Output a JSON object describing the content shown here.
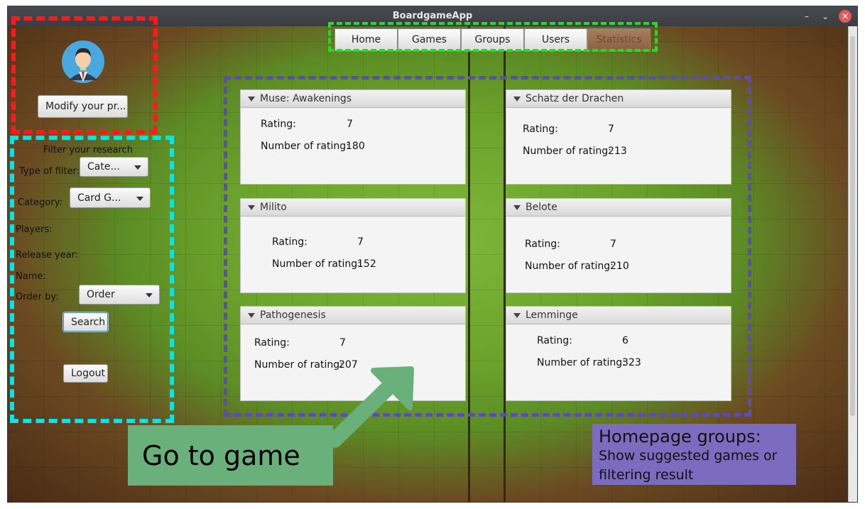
{
  "window": {
    "title": "BoardgameApp",
    "controls": [
      "–",
      "⌄",
      "✕"
    ]
  },
  "nav": {
    "tabs": [
      "Home",
      "Games",
      "Groups",
      "Users",
      "Statistics"
    ]
  },
  "profile": {
    "modify_label": "Modify your pr..."
  },
  "filter": {
    "heading": "Filter your research",
    "type_label": "Type of filter:",
    "type_value": "Cate...",
    "category_label": "Category:",
    "category_value": "Card G...",
    "players_label": "Players:",
    "release_label": "Release year:",
    "name_label": "Name:",
    "order_label": "Order by:",
    "order_value": "Order",
    "search_label": "Search",
    "logout_label": "Logout"
  },
  "games": [
    {
      "name": "Muse: Awakenings",
      "rating_label": "Rating:",
      "rating": "7",
      "count_label": "Number of rating:",
      "count": "180"
    },
    {
      "name": "Schatz der Drachen",
      "rating_label": "Rating:",
      "rating": "7",
      "count_label": "Number of rating:",
      "count": "213"
    },
    {
      "name": "Milito",
      "rating_label": "Rating:",
      "rating": "7",
      "count_label": "Number of rating:",
      "count": "152"
    },
    {
      "name": "Belote",
      "rating_label": "Rating:",
      "rating": "7",
      "count_label": "Number of rating:",
      "count": "210"
    },
    {
      "name": "Pathogenesis",
      "rating_label": "Rating:",
      "rating": "7",
      "count_label": "Number of rating:",
      "count": "207"
    },
    {
      "name": "Lemminge",
      "rating_label": "Rating:",
      "rating": "6",
      "count_label": "Number of rating:",
      "count": "323"
    }
  ],
  "annotations": {
    "go_to_game": "Go to game",
    "homepage_title": "Homepage groups:",
    "homepage_line1": "Show suggested games or",
    "homepage_line2": "filtering result"
  },
  "colors": {
    "red": "#ff1a1a",
    "green": "#22dd22",
    "cyan": "#00e5e5",
    "blue": "#5a4fb0"
  }
}
